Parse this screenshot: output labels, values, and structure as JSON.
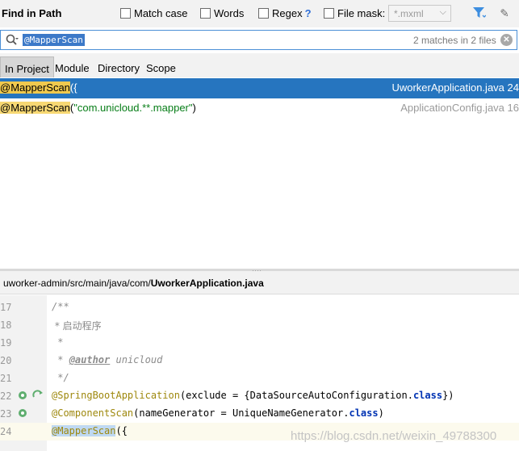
{
  "header": {
    "title": "Find in Path",
    "options": [
      {
        "label": "Match case",
        "checked": false
      },
      {
        "label": "Words",
        "checked": false
      },
      {
        "label": "Regex",
        "checked": false
      },
      {
        "label": "File mask:",
        "checked": false
      }
    ],
    "regex_help": "?",
    "file_mask_value": "*.mxml"
  },
  "search": {
    "query": "@MapperScan",
    "match_count": "2 matches in 2 files"
  },
  "scopes": [
    {
      "label": "In Project",
      "active": true
    },
    {
      "label": "Module",
      "active": false
    },
    {
      "label": "Directory",
      "active": false
    },
    {
      "label": "Scope",
      "active": false
    }
  ],
  "results": [
    {
      "match": "@MapperScan",
      "rest": "({",
      "file": "UworkerApplication.java",
      "line": "24",
      "selected": true
    },
    {
      "match": "@MapperScan",
      "rest_open": "(",
      "rest_string": "\"com.unicloud.**.mapper\"",
      "rest_close": ")",
      "file": "ApplicationConfig.java",
      "line": "16",
      "selected": false
    }
  ],
  "preview": {
    "path_prefix": "uworker-admin/src/main/java/com/",
    "path_file": "UworkerApplication.java",
    "lines": [
      {
        "no": "17",
        "text": "/**"
      },
      {
        "no": "18",
        "text": " * 启动程序"
      },
      {
        "no": "19",
        "text": " *"
      },
      {
        "no": "20",
        "prefix": " * ",
        "tag": "@author",
        "rest": " unicloud"
      },
      {
        "no": "21",
        "text": " */"
      },
      {
        "no": "22",
        "ann": "@SpringBootApplication",
        "rest": "(exclude = {DataSourceAutoConfiguration.",
        "kw": "class",
        "tail": "})"
      },
      {
        "no": "23",
        "ann": "@ComponentScan",
        "rest": "(nameGenerator = UniqueNameGenerator.",
        "kw": "class",
        "tail": ")"
      },
      {
        "no": "24",
        "ann": "@MapperScan",
        "rest": "({"
      }
    ]
  },
  "watermark": "https://blog.csdn.net/weixin_49788300",
  "colors": {
    "accent": "#2675bf",
    "match_highlight": "#f7d873"
  }
}
